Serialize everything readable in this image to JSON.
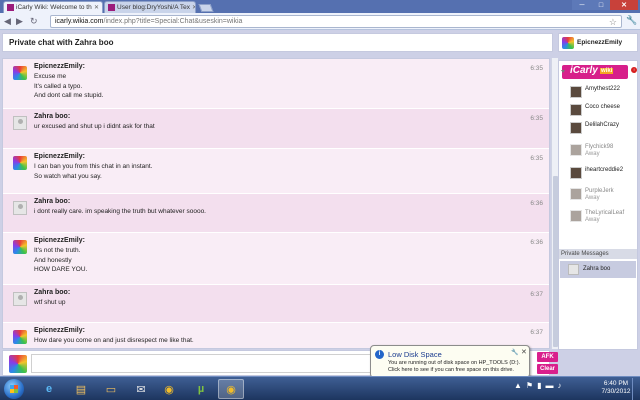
{
  "browser": {
    "tabs": [
      {
        "title": "iCarly Wiki: Welcome to th",
        "active": true
      },
      {
        "title": "User blog:DryYoshi/A Tex",
        "active": false
      }
    ],
    "url_host": "icarly.wikia.com",
    "url_path": "/index.php?title=Special:Chat&useskin=wikia",
    "window_controls": {
      "minimize": "─",
      "maximize": "□",
      "close": "✕"
    }
  },
  "chat": {
    "title": "Private chat with Zahra boo",
    "current_user": "EpicnezzEmily",
    "messages": [
      {
        "author": "EpicnezzEmily:",
        "time": "6:35",
        "lines": [
          "Excuse me",
          "It's called a typo.",
          "And dont call me stupid."
        ],
        "avatar": "swirl"
      },
      {
        "author": "Zahra boo:",
        "time": "6:35",
        "lines": [
          "ur excused and shut up i didnt ask for that"
        ],
        "avatar": "plain"
      },
      {
        "author": "EpicnezzEmily:",
        "time": "6:35",
        "lines": [
          "I can ban you from this chat in an instant.",
          "So watch what you say."
        ],
        "avatar": "swirl"
      },
      {
        "author": "Zahra boo:",
        "time": "6:36",
        "lines": [
          "i dont really care. im speaking the truth but whatever soooo."
        ],
        "avatar": "plain"
      },
      {
        "author": "EpicnezzEmily:",
        "time": "6:36",
        "lines": [
          "It's not the truth.",
          "And honestly",
          "HOW DARE YOU."
        ],
        "avatar": "swirl"
      },
      {
        "author": "Zahra boo:",
        "time": "6:37",
        "lines": [
          "wtf shut up"
        ],
        "avatar": "plain"
      },
      {
        "author": "EpicnezzEmily:",
        "time": "6:37",
        "lines": [
          "How dare you come on and just disrespect me like that."
        ],
        "avatar": "swirl"
      }
    ],
    "input_value": "",
    "afk_label": "AFK",
    "clear_label": "Clear"
  },
  "rail": {
    "logo_text": "iCarly",
    "logo_badge": "wiki",
    "users": [
      {
        "name": "Amythest222",
        "status": ""
      },
      {
        "name": "Coco cheese",
        "status": ""
      },
      {
        "name": "DelilahCrazy",
        "status": ""
      },
      {
        "name": "Flychick98",
        "status": "Away"
      },
      {
        "name": "iheartcreddie2",
        "status": ""
      },
      {
        "name": "PurpleJerk",
        "status": "Away"
      },
      {
        "name": "TheLyricalLeaf",
        "status": "Away"
      }
    ],
    "private_header": "Private Messages",
    "private_items": [
      {
        "name": "Zahra boo"
      }
    ]
  },
  "notification": {
    "title": "Low Disk Space",
    "body_line1": "You are running out of disk space on HP_TOOLS (D:).",
    "body_line2": "Click here to see if you can free space on this drive."
  },
  "taskbar": {
    "time": "6:40 PM",
    "date": "7/30/2012"
  }
}
